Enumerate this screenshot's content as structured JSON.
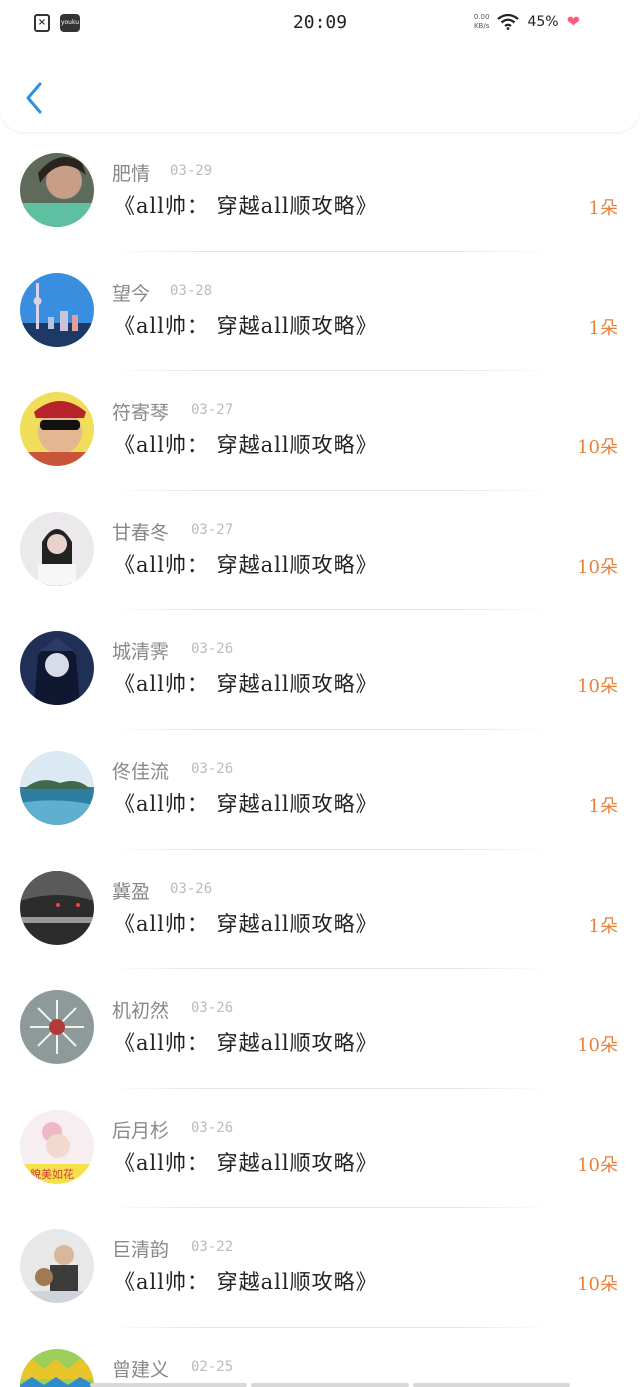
{
  "status_bar": {
    "time": "20:09",
    "net_speed_value": "0.00",
    "net_speed_unit": "KB/s",
    "battery": "45%",
    "left_app_label": "youku"
  },
  "header": {
    "back_icon": "chevron-left-icon"
  },
  "items": [
    {
      "name": "肥情",
      "date": "03-29",
      "title": "《all帅： 穿越all顺攻略》",
      "flowers": "1朵"
    },
    {
      "name": "望今",
      "date": "03-28",
      "title": "《all帅： 穿越all顺攻略》",
      "flowers": "1朵"
    },
    {
      "name": "符寄琴",
      "date": "03-27",
      "title": "《all帅： 穿越all顺攻略》",
      "flowers": "10朵"
    },
    {
      "name": "甘春冬",
      "date": "03-27",
      "title": "《all帅： 穿越all顺攻略》",
      "flowers": "10朵"
    },
    {
      "name": "城清霁",
      "date": "03-26",
      "title": "《all帅： 穿越all顺攻略》",
      "flowers": "10朵"
    },
    {
      "name": "佟佳流",
      "date": "03-26",
      "title": "《all帅： 穿越all顺攻略》",
      "flowers": "1朵"
    },
    {
      "name": "冀盈",
      "date": "03-26",
      "title": "《all帅： 穿越all顺攻略》",
      "flowers": "1朵"
    },
    {
      "name": "机初然",
      "date": "03-26",
      "title": "《all帅： 穿越all顺攻略》",
      "flowers": "10朵"
    },
    {
      "name": "后月杉",
      "date": "03-26",
      "title": "《all帅： 穿越all顺攻略》",
      "flowers": "10朵"
    },
    {
      "name": "巨清韵",
      "date": "03-22",
      "title": "《all帅： 穿越all顺攻略》",
      "flowers": "10朵"
    },
    {
      "name": "曾建义",
      "date": "02-25",
      "title": "",
      "flowers": ""
    }
  ],
  "colors": {
    "accent": "#2f8fe0",
    "flowers": "#e9813a",
    "name": "#888888",
    "date": "#bbbbbb"
  }
}
